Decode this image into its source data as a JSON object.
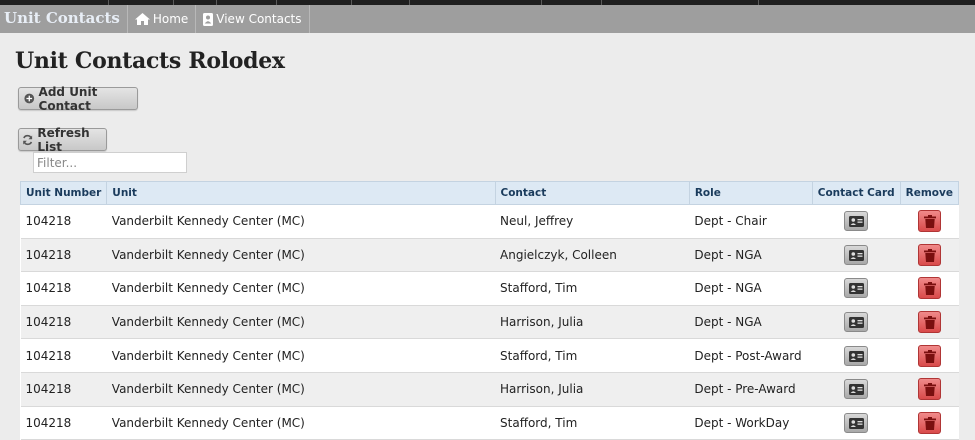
{
  "nav": {
    "brand": "Unit Contacts",
    "home_label": "Home",
    "view_contacts_label": "View Contacts"
  },
  "page_title": "Unit Contacts Rolodex",
  "buttons": {
    "add_label": "Add Unit Contact",
    "refresh_label": "Refresh List"
  },
  "filter": {
    "placeholder": "Filter...",
    "value": ""
  },
  "table": {
    "headers": [
      "Unit Number",
      "Unit",
      "Contact",
      "Role",
      "Contact Card",
      "Remove"
    ],
    "rows": [
      {
        "unit_number": "104218",
        "unit": "Vanderbilt Kennedy Center (MC)",
        "contact": "Neul, Jeffrey",
        "role": "Dept - Chair"
      },
      {
        "unit_number": "104218",
        "unit": "Vanderbilt Kennedy Center (MC)",
        "contact": "Angielczyk, Colleen",
        "role": "Dept - NGA"
      },
      {
        "unit_number": "104218",
        "unit": "Vanderbilt Kennedy Center (MC)",
        "contact": "Stafford, Tim",
        "role": "Dept - NGA"
      },
      {
        "unit_number": "104218",
        "unit": "Vanderbilt Kennedy Center (MC)",
        "contact": "Harrison, Julia",
        "role": "Dept - NGA"
      },
      {
        "unit_number": "104218",
        "unit": "Vanderbilt Kennedy Center (MC)",
        "contact": "Stafford, Tim",
        "role": "Dept - Post-Award"
      },
      {
        "unit_number": "104218",
        "unit": "Vanderbilt Kennedy Center (MC)",
        "contact": "Harrison, Julia",
        "role": "Dept - Pre-Award"
      },
      {
        "unit_number": "104218",
        "unit": "Vanderbilt Kennedy Center (MC)",
        "contact": "Stafford, Tim",
        "role": "Dept - WorkDay"
      }
    ]
  },
  "icons": {
    "home": "home-icon",
    "view_contacts": "contact-book-icon",
    "add": "plus-circle-icon",
    "refresh": "refresh-icon",
    "contact_card": "id-card-icon",
    "remove": "trash-icon"
  },
  "colors": {
    "navbar": "#9e9e9e",
    "header_bg": "#dde9f4",
    "remove_button": "#e05555",
    "card_button": "#b8b8b8"
  }
}
